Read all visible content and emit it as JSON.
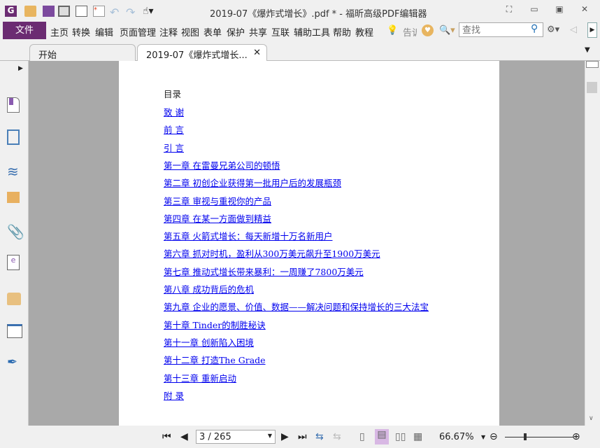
{
  "window": {
    "title": "2019-07《爆炸式增长》.pdf * - 福昕高级PDF编辑器"
  },
  "menu": {
    "file": "文件",
    "items": [
      "主页",
      "转换",
      "编辑",
      "页面管理",
      "注释",
      "视图",
      "表单",
      "保护",
      "共享",
      "互联",
      "辅助工具",
      "帮助",
      "教程"
    ],
    "tell": "告诉",
    "search_placeholder": "查找"
  },
  "tabs": [
    {
      "label": "开始"
    },
    {
      "label": "2019-07《爆炸式增长..."
    }
  ],
  "document": {
    "heading": "目录",
    "toc": [
      "致 谢",
      "前 言",
      "引 言",
      "第一章 在雷曼兄弟公司的顿悟",
      "第二章 初创企业获得第一批用户后的发展瓶颈",
      "第三章 审视与重视你的产品",
      "第四章 在某一方面做到精益",
      "第五章 火箭式增长：每天新增十万名新用户",
      "第六章 抓对时机，盈利从300万美元飙升至1900万美元",
      "第七章 推动式增长带来暴利：一周赚了7800万美元",
      "第八章 成功背后的危机",
      "第九章 企业的愿景、价值、数据——解决问题和保持增长的三大法宝",
      "第十章 Tinder的制胜秘诀",
      "第十一章 创新陷入困境",
      "第十二章 打造The Grade",
      "第十三章 重新启动",
      "附 录"
    ]
  },
  "status": {
    "page": "3 / 265",
    "zoom": "66.67%"
  },
  "colors": {
    "brand": "#6b2c72",
    "link": "#0000ee"
  }
}
